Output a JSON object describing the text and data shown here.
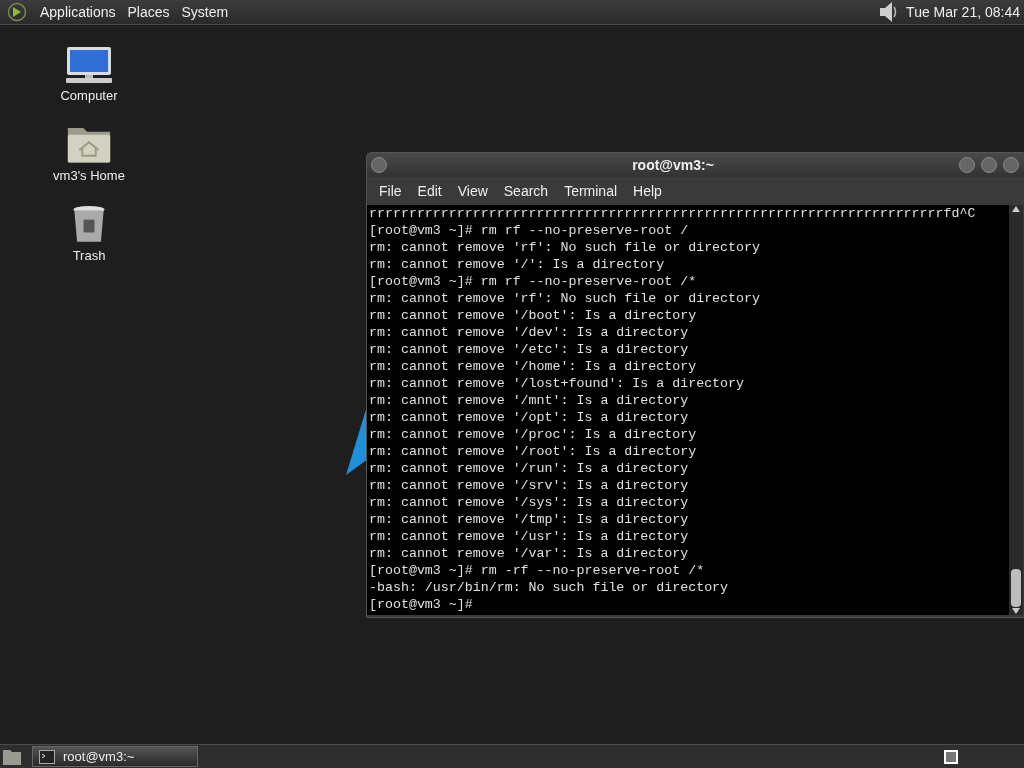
{
  "top_panel": {
    "menus": [
      "Applications",
      "Places",
      "System"
    ],
    "clock": "Tue Mar 21, 08:44"
  },
  "desktop_icons": [
    {
      "kind": "computer",
      "label": "Computer"
    },
    {
      "kind": "home",
      "label": "vm3's Home"
    },
    {
      "kind": "trash",
      "label": "Trash"
    }
  ],
  "terminal": {
    "title": "root@vm3:~",
    "menu": [
      "File",
      "Edit",
      "View",
      "Search",
      "Terminal",
      "Help"
    ],
    "lines": [
      "rrrrrrrrrrrrrrrrrrrrrrrrrrrrrrrrrrrrrrrrrrrrrrrrrrrrrrrrrrrrrrrrrrrrrrrrfd^C",
      "[root@vm3 ~]# rm rf --no-preserve-root /",
      "rm: cannot remove 'rf': No such file or directory",
      "rm: cannot remove '/': Is a directory",
      "[root@vm3 ~]# rm rf --no-preserve-root /*",
      "rm: cannot remove 'rf': No such file or directory",
      "rm: cannot remove '/boot': Is a directory",
      "rm: cannot remove '/dev': Is a directory",
      "rm: cannot remove '/etc': Is a directory",
      "rm: cannot remove '/home': Is a directory",
      "rm: cannot remove '/lost+found': Is a directory",
      "rm: cannot remove '/mnt': Is a directory",
      "rm: cannot remove '/opt': Is a directory",
      "rm: cannot remove '/proc': Is a directory",
      "rm: cannot remove '/root': Is a directory",
      "rm: cannot remove '/run': Is a directory",
      "rm: cannot remove '/srv': Is a directory",
      "rm: cannot remove '/sys': Is a directory",
      "rm: cannot remove '/tmp': Is a directory",
      "rm: cannot remove '/usr': Is a directory",
      "rm: cannot remove '/var': Is a directory",
      "[root@vm3 ~]# rm -rf --no-preserve-root /*",
      "-bash: /usr/bin/rm: No such file or directory",
      "[root@vm3 ~]#"
    ]
  },
  "taskbar": {
    "tasks": [
      {
        "label": "root@vm3:~",
        "selected": true
      }
    ]
  }
}
